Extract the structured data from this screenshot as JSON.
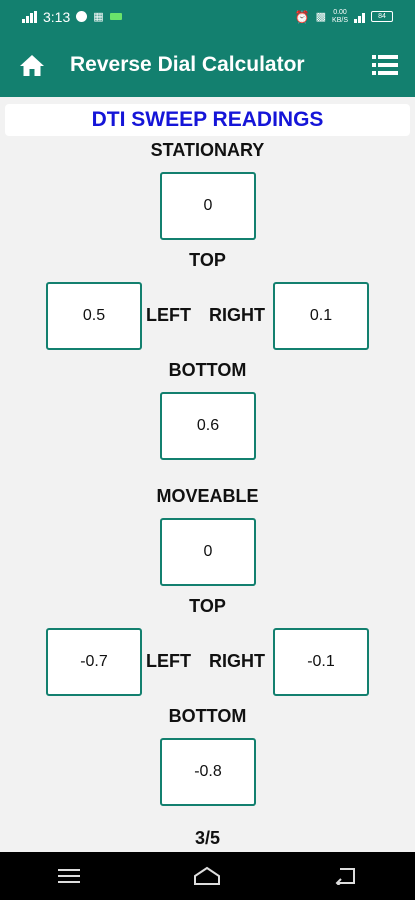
{
  "status_bar": {
    "time": "3:13",
    "speed_value": "0.00",
    "speed_unit": "KB/S",
    "battery": "84"
  },
  "app_bar": {
    "title": "Reverse Dial Calculator",
    "home_icon": "home-icon",
    "menu_icon": "list-menu-icon"
  },
  "banner": {
    "title": "DTI SWEEP READINGS"
  },
  "stationary": {
    "heading": "STATIONARY",
    "center": "0",
    "top_label": "TOP",
    "left": "0.5",
    "left_label": "LEFT",
    "right_label": "RIGHT",
    "right": "0.1",
    "bottom_label": "BOTTOM",
    "bottom": "0.6"
  },
  "moveable": {
    "heading": "MOVEABLE",
    "center": "0",
    "top_label": "TOP",
    "left": "-0.7",
    "left_label": "LEFT",
    "right_label": "RIGHT",
    "right": "-0.1",
    "bottom_label": "BOTTOM",
    "bottom": "-0.8"
  },
  "page_indicator": "3/5",
  "colors": {
    "primary": "#13806f",
    "banner_text": "#1515d8",
    "background": "#f2f2f2"
  }
}
